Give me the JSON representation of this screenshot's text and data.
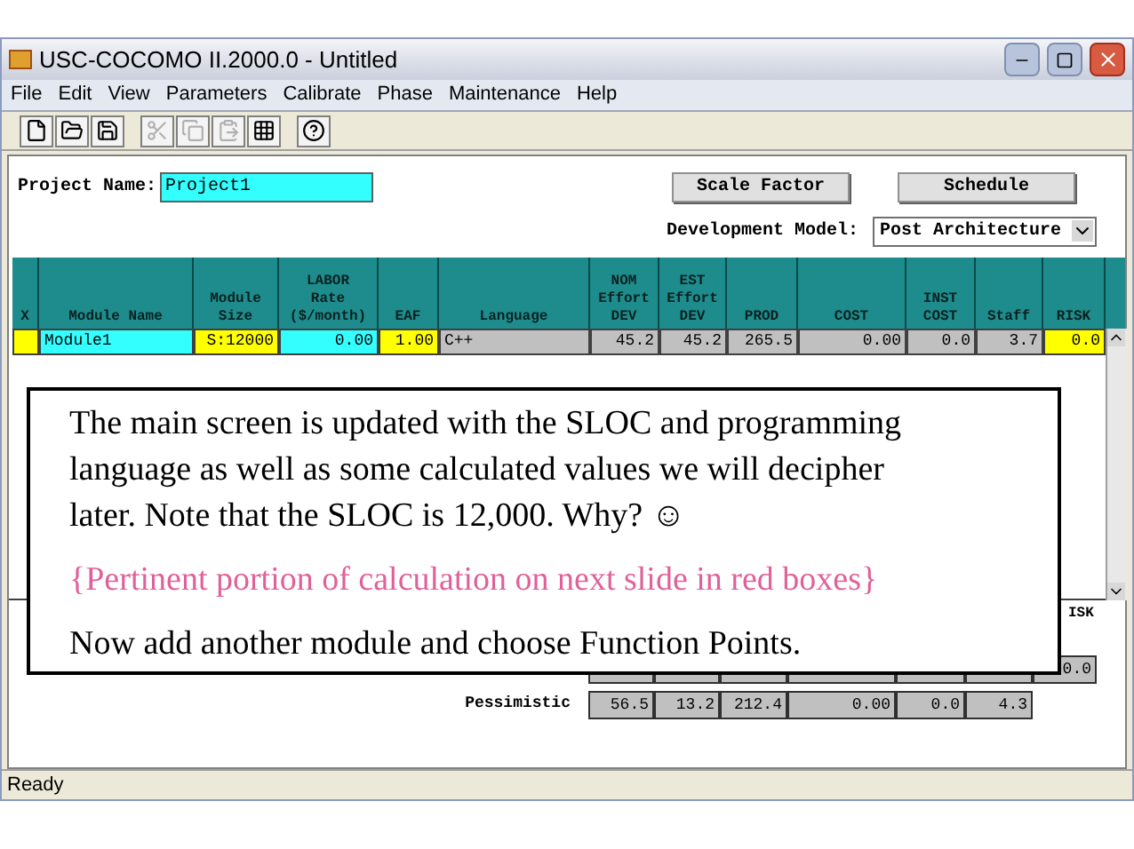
{
  "window": {
    "title": "USC-COCOMO II.2000.0 - Untitled"
  },
  "menu": [
    "File",
    "Edit",
    "View",
    "Parameters",
    "Calibrate",
    "Phase",
    "Maintenance",
    "Help"
  ],
  "toolbar": [
    {
      "kind": "new",
      "disabled": false
    },
    {
      "kind": "open",
      "disabled": false
    },
    {
      "kind": "save",
      "disabled": false
    },
    {
      "kind": "cut",
      "disabled": true
    },
    {
      "kind": "copy",
      "disabled": true
    },
    {
      "kind": "paste",
      "disabled": true
    },
    {
      "kind": "grid",
      "disabled": false
    },
    {
      "kind": "help",
      "disabled": false
    }
  ],
  "project": {
    "label": "Project Name:",
    "value": "Project1"
  },
  "buttons": [
    "Scale Factor",
    "Schedule"
  ],
  "development_model": {
    "label": "Development Model:",
    "value": "Post Architecture"
  },
  "table": {
    "columns": [
      "X",
      "Module Name",
      "Module\nSize",
      "LABOR\nRate\n($/month)",
      "EAF",
      "Language",
      "NOM\nEffort\nDEV",
      "EST\nEffort\nDEV",
      "PROD",
      "COST",
      "INST\nCOST",
      "Staff",
      "RISK"
    ],
    "rows": [
      {
        "cells": [
          {
            "text": "",
            "color": "#ffff00"
          },
          {
            "text": "Module1",
            "color": "#33ffff"
          },
          {
            "text": "S:12000",
            "color": "#ffff00"
          },
          {
            "text": "0.00",
            "color": "#33ffff"
          },
          {
            "text": "1.00",
            "color": "#ffff00"
          },
          {
            "text": "C++",
            "color": "#c0c0c0"
          },
          {
            "text": "45.2",
            "color": "#c0c0c0"
          },
          {
            "text": "45.2",
            "color": "#c0c0c0"
          },
          {
            "text": "265.5",
            "color": "#c0c0c0"
          },
          {
            "text": "0.00",
            "color": "#c0c0c0"
          },
          {
            "text": "0.0",
            "color": "#c0c0c0"
          },
          {
            "text": "3.7",
            "color": "#c0c0c0"
          },
          {
            "text": "0.0",
            "color": "#ffff00"
          }
        ]
      }
    ]
  },
  "estimates": {
    "heading": "ISK",
    "rows": [
      {
        "label": "",
        "cells": [
          "",
          "",
          "",
          "",
          "",
          "",
          "0.0"
        ]
      },
      {
        "label": "Pessimistic",
        "cells": [
          "56.5",
          "13.2",
          "212.4",
          "0.00",
          "0.0",
          "4.3"
        ]
      }
    ]
  },
  "note": {
    "paragraphs": [
      {
        "kind": "normal",
        "text": "The main screen is updated with the SLOC and programming language as well as some calculated values we will decipher later. Note that the SLOC is 12,000. Why? ☺"
      },
      {
        "kind": "highlight",
        "text": "{Pertinent portion of calculation on next slide in red boxes}"
      },
      {
        "kind": "normal",
        "text": "Now add another module and choose Function Points."
      }
    ]
  },
  "status_bar": "Ready"
}
